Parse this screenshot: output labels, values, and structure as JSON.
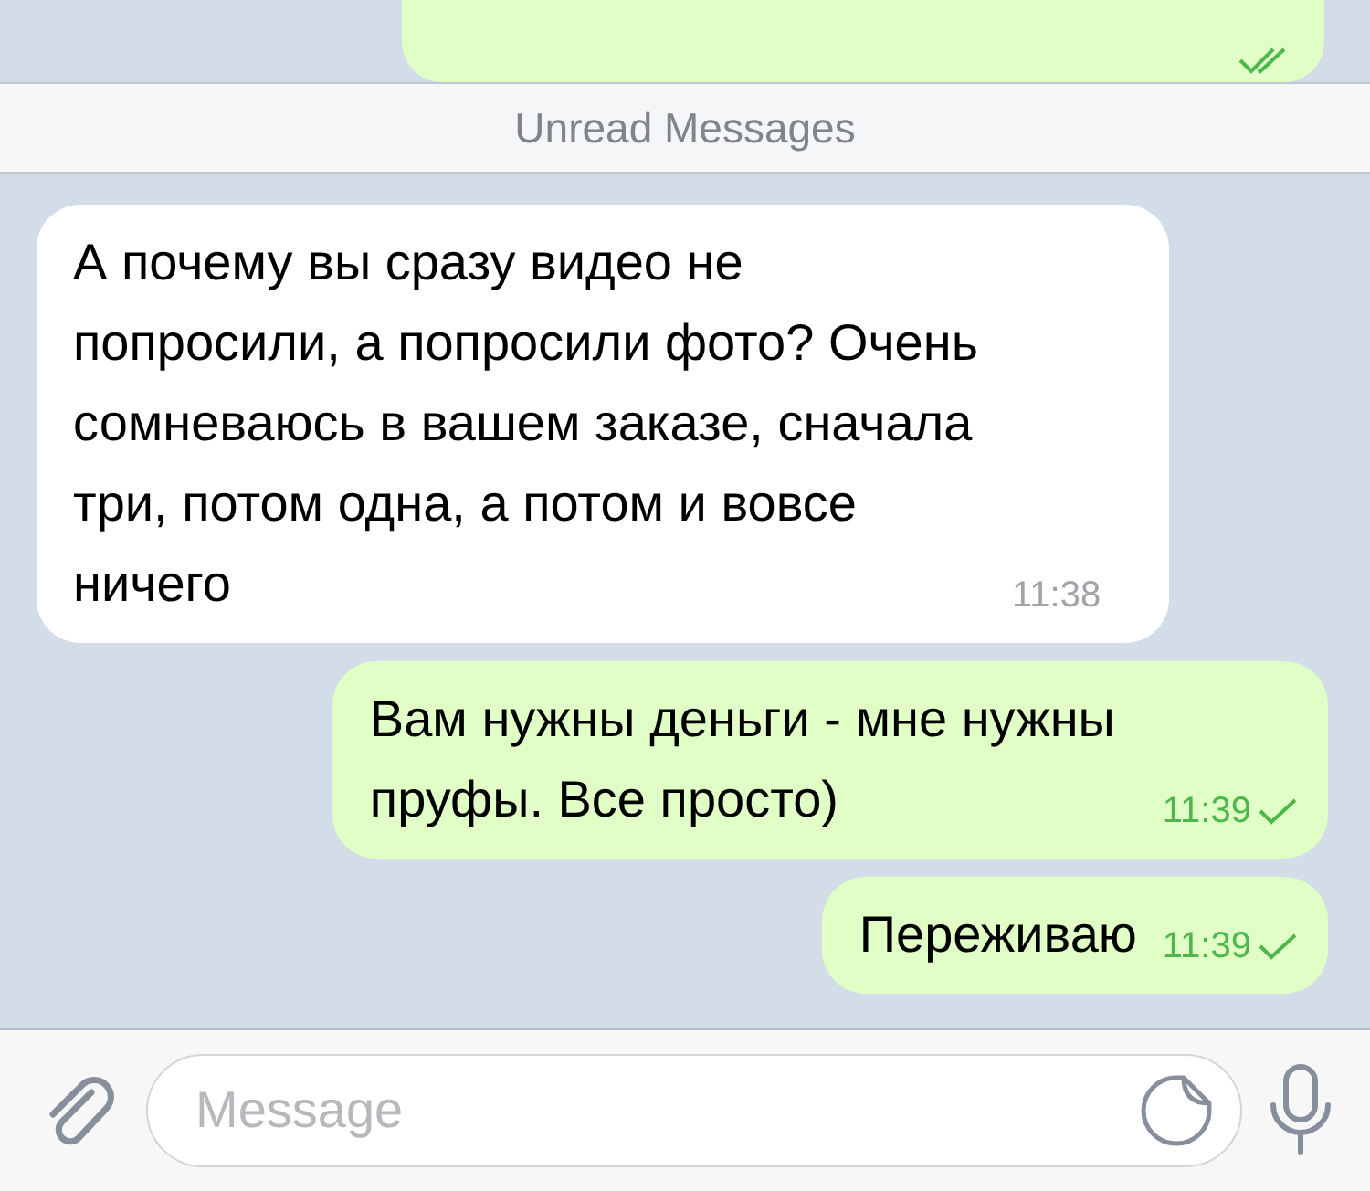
{
  "clipped_message": {
    "read": true
  },
  "divider": {
    "label": "Unread Messages"
  },
  "messages": [
    {
      "kind": "incoming",
      "text": "А почему вы сразу видео не попросили, а попросили фото? Очень сомневаюсь в вашем заказе, сначала три, потом одна, а потом и вовсе ничего",
      "time": "11:38"
    },
    {
      "kind": "outgoing",
      "text": "Вам нужны деньги - мне нужны пруфы. Все просто)",
      "time": "11:39",
      "read": false
    },
    {
      "kind": "outgoing",
      "text": "Переживаю",
      "time": "11:39",
      "read": false
    }
  ],
  "composer": {
    "placeholder": "Message"
  }
}
